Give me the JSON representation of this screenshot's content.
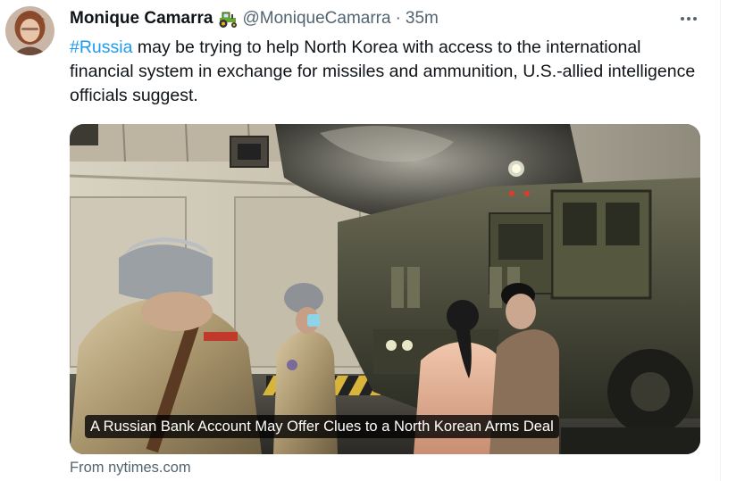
{
  "tweet": {
    "author_name": "Monique Camarra",
    "author_emoji": "tractor-icon",
    "handle": "@MoniqueCamarra",
    "separator": "·",
    "time": "35m",
    "text": {
      "hashtag": "#Russia",
      "body": " may be trying to help North Korea with access to the international financial system in exchange for missiles and ammunition, U.S.-allied intelligence officials suggest."
    }
  },
  "card": {
    "headline": "A Russian Bank Account May Offer Clues to a North Korean Arms Deal",
    "source": "From nytimes.com"
  },
  "colors": {
    "link": "#1d9bf0",
    "secondary_text": "#536471",
    "primary_text": "#0f1419",
    "divider": "#eff3f4"
  },
  "icons": {
    "more": "more-horizontal-icon",
    "avatar": "avatar",
    "tractor": "tractor-icon"
  }
}
